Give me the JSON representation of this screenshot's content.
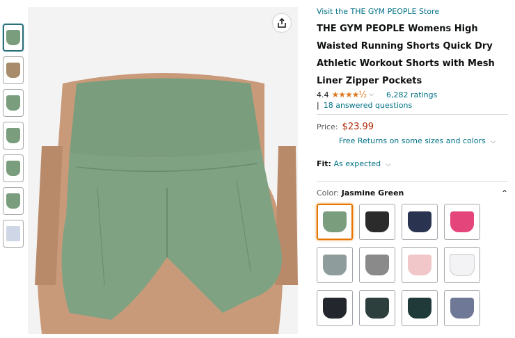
{
  "store_link": "Visit the THE GYM PEOPLE Store",
  "title_lines": [
    "THE GYM PEOPLE Womens High",
    "Waisted Running Shorts Quick Dry",
    "Athletic Workout Shorts with Mesh",
    "Liner Zipper Pockets"
  ],
  "rating": {
    "value": "4.4",
    "stars": "★★★★½",
    "count": "6,282 ratings"
  },
  "questions": "18 answered questions",
  "price": {
    "label": "Price:",
    "amount": "$23.99",
    "returns": "Free Returns on some sizes and colors"
  },
  "fit": {
    "label": "Fit:",
    "value": "As expected"
  },
  "color": {
    "label": "Color:",
    "value": "Jasmine Green"
  },
  "colors": {
    "main_short": "#7a9d7e",
    "swatches": [
      "#7a9d7e",
      "#2b2b2b",
      "#2a3450",
      "#e4457a",
      "#8e9c9c",
      "#8a8a8a",
      "#f2c7c9",
      "#f3f3f6",
      "#24262d",
      "#2c3f3d",
      "#1f3a38",
      "#6f7896"
    ],
    "thumbs": [
      "#7a9d7e",
      "#8a7a6a",
      "#7a9d7e",
      "#7a9d7e",
      "#7a9d7e",
      "#7a9d7e",
      "#cfd6e6"
    ]
  }
}
